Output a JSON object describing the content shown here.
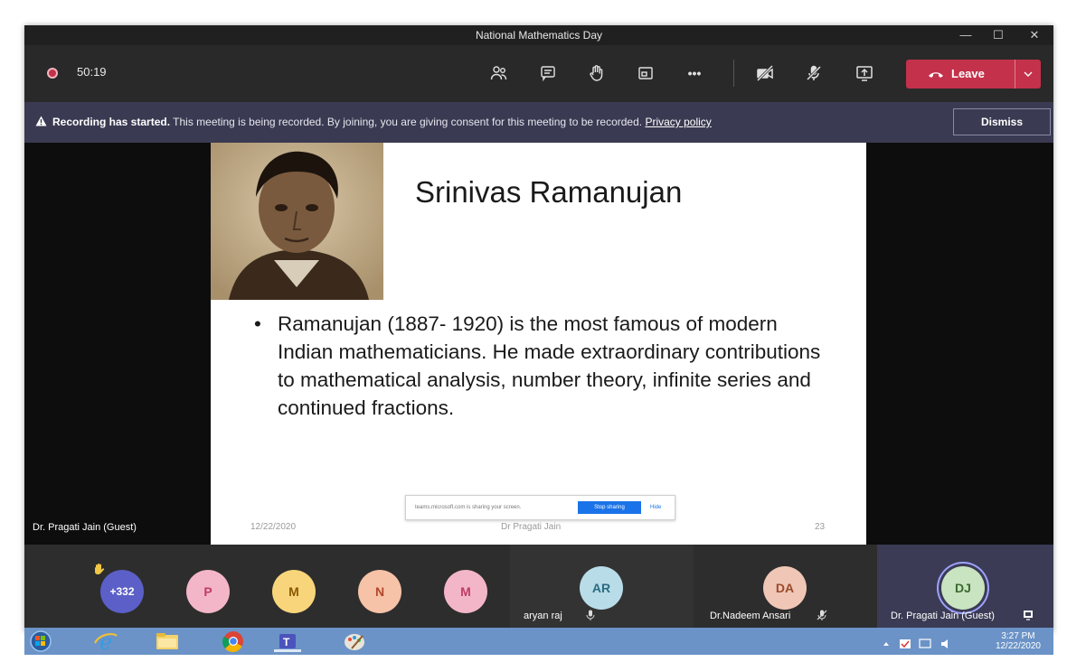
{
  "window": {
    "title": "National Mathematics Day",
    "minimize_glyph": "—",
    "maximize_glyph": "☐",
    "close_glyph": "✕"
  },
  "toolbar": {
    "timer": "50:19",
    "leave_label": "Leave",
    "icons": [
      "participants-icon",
      "chat-icon",
      "raise-hand-icon",
      "rooms-icon",
      "more-icon",
      "camera-off-icon",
      "mic-off-icon",
      "share-screen-icon"
    ],
    "more_glyph": "•••"
  },
  "banner": {
    "bold": "Recording has started.",
    "message": " This meeting is being recorded. By joining, you are giving consent for this meeting to be recorded. ",
    "link": "Privacy policy",
    "dismiss": "Dismiss"
  },
  "slide": {
    "title": "Srinivas Ramanujan",
    "bullet_glyph": "•",
    "bullet": "Ramanujan (1887- 1920) is the most famous of modern Indian mathematicians. He made extraordinary contributions to mathematical analysis, number theory, infinite series and continued fractions.",
    "footer_date": "12/22/2020",
    "footer_author": "Dr Pragati Jain",
    "footer_page": "23"
  },
  "share_bar": {
    "message": "teams.microsoft.com is sharing your screen.",
    "stop": "Stop sharing",
    "hide": "Hide"
  },
  "stage": {
    "presenter_name": "Dr. Pragati Jain (Guest)"
  },
  "roster": {
    "overflow": "+332",
    "circles": [
      {
        "initial": "P",
        "color": "#f3b6c8"
      },
      {
        "initial": "M",
        "color": "#f8d57a"
      },
      {
        "initial": "N",
        "color": "#f6c2a8"
      },
      {
        "initial": "M",
        "color": "#f3b6c8"
      }
    ],
    "tiles": [
      {
        "initials": "AR",
        "name": "aryan raj",
        "color": "#b9dde8"
      },
      {
        "initials": "DA",
        "name": "Dr.Nadeem Ansari",
        "color": "#f0c7b6"
      },
      {
        "initials": "DJ",
        "name": "Dr. Pragati Jain (Guest)",
        "color": "#c8e4c0"
      }
    ]
  },
  "taskbar": {
    "time": "3:27 PM",
    "date": "12/22/2020"
  }
}
